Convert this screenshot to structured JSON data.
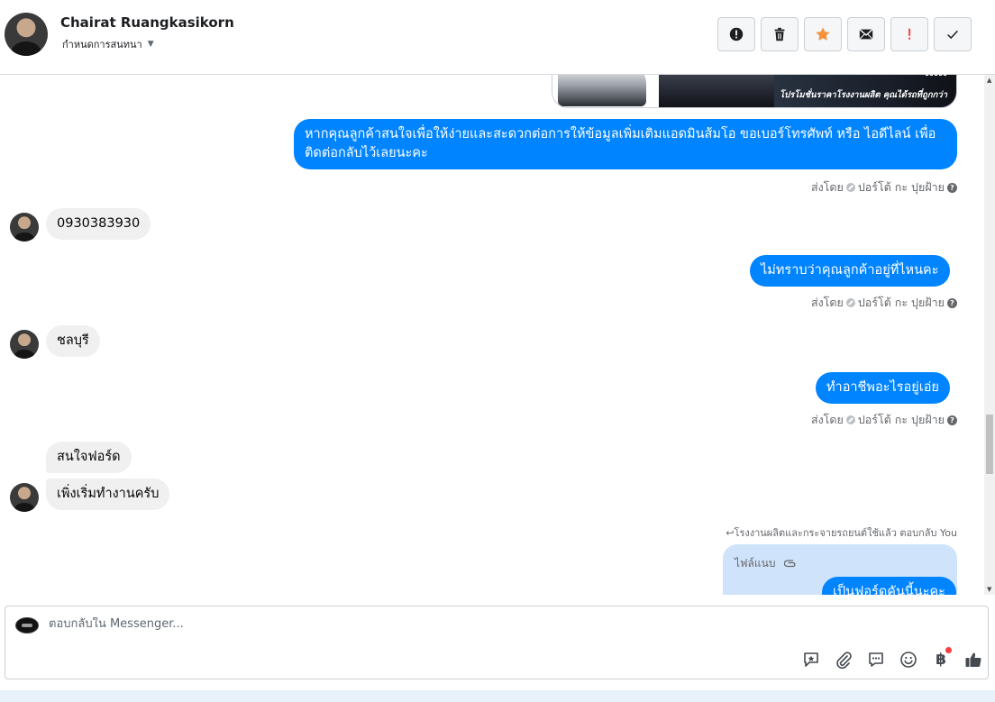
{
  "header": {
    "name": "Chairat Ruangkasikorn",
    "subtitle": "กำหนดการสนทนา",
    "actions": [
      {
        "name": "report-button",
        "icon": "exclamation-circle-icon"
      },
      {
        "name": "delete-button",
        "icon": "trash-icon"
      },
      {
        "name": "star-button",
        "icon": "star-icon",
        "color": "#f7923b"
      },
      {
        "name": "mark-unread-button",
        "icon": "envelope-icon"
      },
      {
        "name": "spam-button",
        "icon": "exclamation-icon",
        "color": "#fa3e3e"
      },
      {
        "name": "done-button",
        "icon": "checkmark-icon"
      }
    ]
  },
  "messages": {
    "image_caption": "โปรโมชั่นราคาโรงงานผลิต คุณได้รถที่ถูกกว่า",
    "out_1": "หากคุณลูกค้าสนใจเพื่อให้ง่ายและสะดวกต่อการให้ข้อมูลเพิ่มเติมแอดมินส้มโอ ขอเบอร์โทรศัพท์ หรือ ไอดีไลน์ เพื่อติดต่อกลับไว้เลยนะคะ",
    "in_1": "0930383930",
    "out_2": "ไม่ทราบว่าคุณลูกค้าอยู่ที่ไหนคะ",
    "in_2": "ชลบุรี",
    "out_3": "ทำอาชีพอะไรอยู่เอ่ย",
    "in_3": "สนใจฟอร์ด",
    "in_4": "เพิ่งเริ่มทำงานครับ",
    "reply_note": "โรงงานผลิตและกระจายรถยนต์ใช้แล้ว ตอบกลับ You",
    "reply_quote_label": "ไฟล์แนบ",
    "out_4": "เป็นฟอร์ดคันนี้นะคะ"
  },
  "sent_by": {
    "prefix": "ส่งโดย",
    "agent": "ปอร์โต้ กะ ปุยฝ้าย"
  },
  "composer": {
    "placeholder": "ตอบกลับใน Messenger...",
    "tools": [
      "saved-reply-icon",
      "attachment-icon",
      "chat-bubble-icon",
      "emoji-icon",
      "baht-payment-icon",
      "thumbs-up-icon"
    ],
    "baht_symbol": "฿"
  },
  "colors": {
    "outgoing_bubble": "#0084ff",
    "incoming_bubble": "#f0f0f0",
    "reply_quote_bg": "#cfe3fb"
  }
}
